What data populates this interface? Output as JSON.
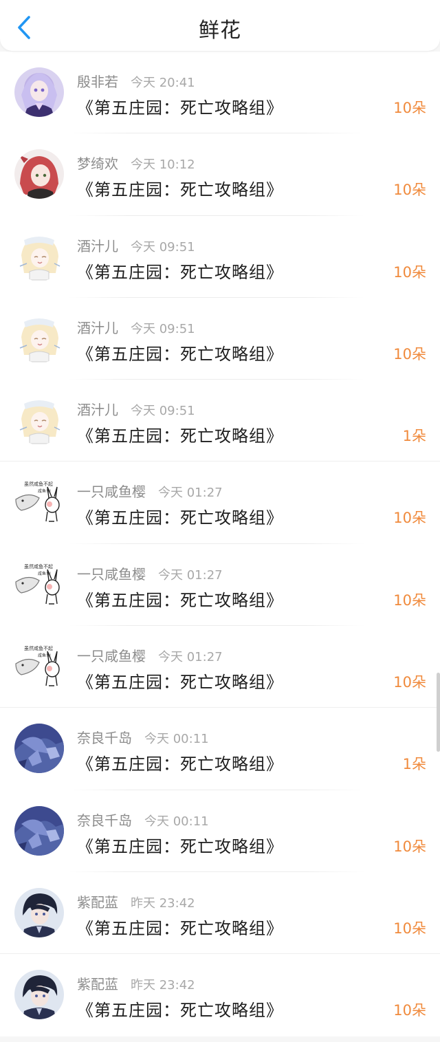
{
  "header": {
    "title": "鲜花",
    "back_icon": "chevron-left-icon",
    "accent": "#2196f3"
  },
  "colors": {
    "count": "#f08a3c"
  },
  "items": [
    {
      "name": "殷非若",
      "time": "今天 20:41",
      "book": "《第五庄园：死亡攻略组》",
      "count": "10朵",
      "avatar": "anime-girl-lavender"
    },
    {
      "name": "梦绮欢",
      "time": "今天 10:12",
      "book": "《第五庄园：死亡攻略组》",
      "count": "10朵",
      "avatar": "anime-girl-red-hair"
    },
    {
      "name": "酒汁儿",
      "time": "今天 09:51",
      "book": "《第五庄园：死亡攻略组》",
      "count": "10朵",
      "avatar": "anime-sketch-blonde"
    },
    {
      "name": "酒汁儿",
      "time": "今天 09:51",
      "book": "《第五庄园：死亡攻略组》",
      "count": "10朵",
      "avatar": "anime-sketch-blonde"
    },
    {
      "name": "酒汁儿",
      "time": "今天 09:51",
      "book": "《第五庄园：死亡攻略组》",
      "count": "1朵",
      "avatar": "anime-sketch-blonde"
    },
    {
      "name": "一只咸鱼樱",
      "time": "今天 01:27",
      "book": "《第五庄园：死亡攻略组》",
      "count": "10朵",
      "avatar": "fish-rabbit-meme"
    },
    {
      "name": "一只咸鱼樱",
      "time": "今天 01:27",
      "book": "《第五庄园：死亡攻略组》",
      "count": "10朵",
      "avatar": "fish-rabbit-meme"
    },
    {
      "name": "一只咸鱼樱",
      "time": "今天 01:27",
      "book": "《第五庄园：死亡攻略组》",
      "count": "10朵",
      "avatar": "fish-rabbit-meme"
    },
    {
      "name": "奈良千岛",
      "time": "今天 00:11",
      "book": "《第五庄园：死亡攻略组》",
      "count": "1朵",
      "avatar": "blue-night-scene"
    },
    {
      "name": "奈良千岛",
      "time": "今天 00:11",
      "book": "《第五庄园：死亡攻略组》",
      "count": "10朵",
      "avatar": "blue-night-scene"
    },
    {
      "name": "紫配蓝",
      "time": "昨天 23:42",
      "book": "《第五庄园：死亡攻略组》",
      "count": "10朵",
      "avatar": "anime-boy-dark"
    },
    {
      "name": "紫配蓝",
      "time": "昨天 23:42",
      "book": "《第五庄园：死亡攻略组》",
      "count": "10朵",
      "avatar": "anime-boy-dark"
    }
  ]
}
